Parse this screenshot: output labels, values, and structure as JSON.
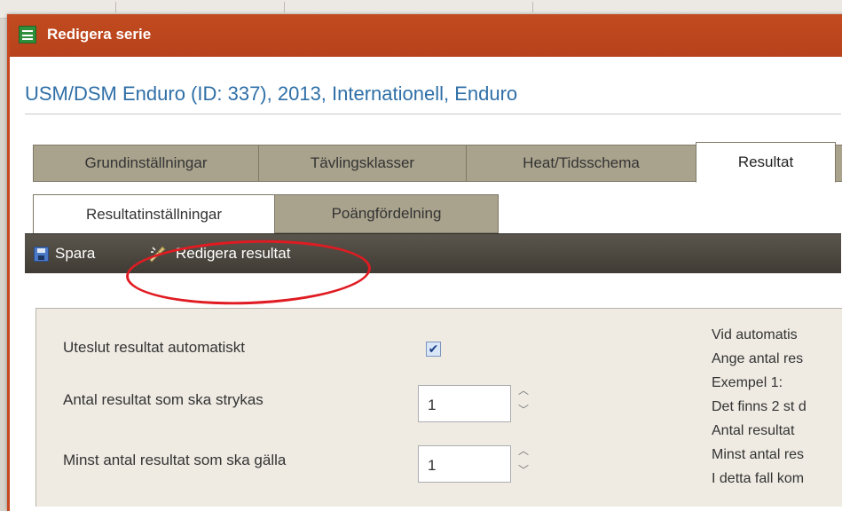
{
  "window": {
    "title": "Redigera serie"
  },
  "series_title": "USM/DSM Enduro (ID: 337), 2013, Internationell, Enduro",
  "tabs": [
    {
      "label": "Grundinställningar"
    },
    {
      "label": "Tävlingsklasser"
    },
    {
      "label": "Heat/Tidsschema"
    },
    {
      "label": "Resultat"
    }
  ],
  "subtabs": [
    {
      "label": "Resultatinställningar"
    },
    {
      "label": "Poängfördelning"
    }
  ],
  "toolbar": {
    "save_label": "Spara",
    "edit_results_label": "Redigera resultat"
  },
  "form": {
    "exclude_auto_label": "Uteslut resultat automatiskt",
    "exclude_auto_checked": true,
    "remove_count_label": "Antal resultat som ska strykas",
    "remove_count_value": "1",
    "min_count_label": "Minst antal resultat som ska gälla",
    "min_count_value": "1"
  },
  "help_lines": [
    "Vid automatis",
    "Ange antal res",
    "Exempel 1:",
    "Det finns 2 st d",
    "Antal resultat",
    "Minst antal res",
    "I detta fall kom"
  ],
  "colors": {
    "titlebar": "#c24b20",
    "toolbar": "#4a463e",
    "tab_inactive": "#a9a38d",
    "accent_title": "#2f6fa7",
    "annotation": "#e01b22"
  }
}
